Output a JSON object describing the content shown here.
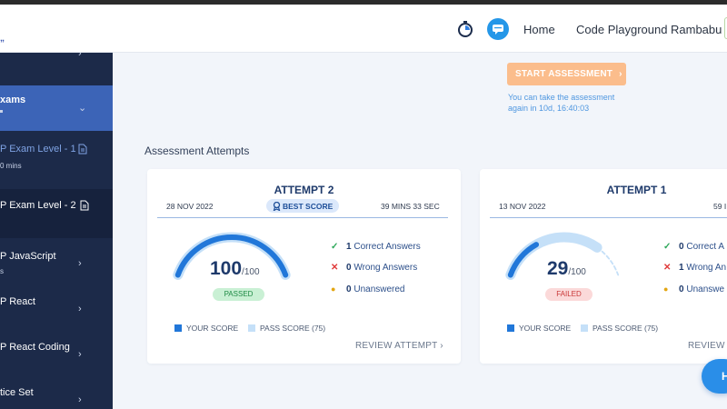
{
  "header": {
    "logo_fragment": "„",
    "nav": {
      "home": "Home",
      "code_playground": "Code Playground",
      "user": "Rambabu"
    }
  },
  "sidebar": {
    "items": [
      {
        "label": "",
        "sub": "",
        "chevron": "›"
      },
      {
        "label": "xams",
        "sub": "",
        "chevron": "⌄"
      },
      {
        "label": "P Exam Level - 1",
        "sub": "0 mins"
      },
      {
        "label": "P Exam Level - 2",
        "sub": ""
      },
      {
        "label": "P JavaScript",
        "sub": "s",
        "chevron": "›"
      },
      {
        "label": "P React",
        "sub": "",
        "chevron": "›"
      },
      {
        "label": "P React Coding",
        "sub": "",
        "chevron": "›"
      },
      {
        "label": "tice Set",
        "sub": "",
        "chevron": "›"
      }
    ]
  },
  "assessment": {
    "start_button": "START ASSESSMENT",
    "start_chevron": "›",
    "retake_note": "You can take the assessment again in 10d, 16:40:03",
    "section_title": "Assessment Attempts"
  },
  "attempts": [
    {
      "title": "ATTEMPT 2",
      "date": "28 NOV 2022",
      "duration": "39 MINS 33 SEC",
      "badge": "BEST SCORE",
      "score": "100",
      "score_max": "/100",
      "score_fraction": 1.0,
      "status": "PASSED",
      "correct": "1",
      "correct_label": "Correct Answers",
      "wrong": "0",
      "wrong_label": "Wrong Answers",
      "unanswered": "0",
      "unanswered_label": "Unanswered",
      "legend_your": "YOUR SCORE",
      "legend_pass": "PASS SCORE (75)",
      "review": "REVIEW ATTEMPT",
      "review_chevron": "›"
    },
    {
      "title": "ATTEMPT 1",
      "date": "13 NOV 2022",
      "duration": "59 I",
      "score": "29",
      "score_max": "/100",
      "score_fraction": 0.29,
      "status": "FAILED",
      "correct": "0",
      "correct_label": "Correct A",
      "wrong": "1",
      "wrong_label": "Wrong An",
      "unanswered": "0",
      "unanswered_label": "Unanswe",
      "legend_your": "YOUR SCORE",
      "legend_pass": "PASS SCORE (75)",
      "review": "REVIEW A"
    }
  ],
  "pass_score_fraction": 0.75,
  "fab_label": "H",
  "colors": {
    "accent": "#2177d9",
    "pass_track": "#c5e0f8",
    "sidebar": "#1c2a49",
    "sidebar_active": "#3c64b7",
    "start_button": "#fbbd8c",
    "passed": "#1d8a44",
    "failed": "#c93838"
  }
}
